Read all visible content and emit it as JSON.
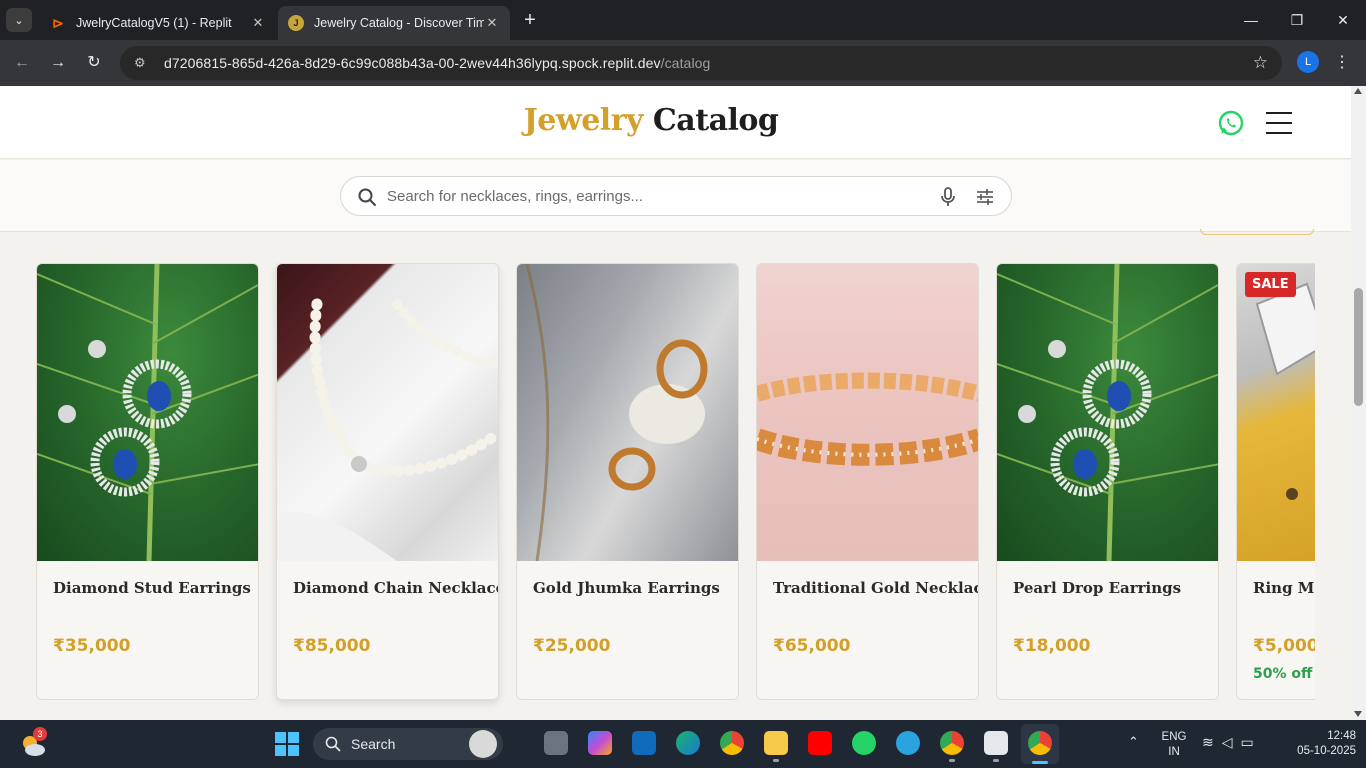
{
  "browser": {
    "tabs": [
      {
        "title": "JwelryCatalogV5 (1) - Replit",
        "favicon": "replit-icon",
        "active": false
      },
      {
        "title": "Jewelry Catalog - Discover Time",
        "favicon": "J",
        "active": true
      }
    ],
    "url_host": "d7206815-865d-426a-8d29-6c99c088b43a-00-2wev44h36lypq.spock.replit.dev",
    "url_path": "/catalog",
    "profile_initial": "L"
  },
  "site": {
    "logo_part1": "Jewelry",
    "logo_part2": "Catalog",
    "accent_color": "#d4a02c",
    "search_placeholder": "Search for necklaces, rings, earrings..."
  },
  "products": [
    {
      "name": "Diamond Stud Earrings",
      "price": "₹35,000",
      "image": "earrings-on-leaf"
    },
    {
      "name": "Diamond Chain Necklace",
      "price": "₹85,000",
      "image": "pearl-necklace"
    },
    {
      "name": "Gold Jhumka Earrings",
      "price": "₹25,000",
      "image": "gold-hoop-earrings"
    },
    {
      "name": "Traditional Gold Necklace",
      "price": "₹65,000",
      "image": "gold-bracelet"
    },
    {
      "name": "Pearl Drop Earrings",
      "price": "₹18,000",
      "image": "earrings-on-leaf"
    },
    {
      "name": "Ring Men",
      "price": "₹5,000",
      "discount": "50% off",
      "badge": "SALE",
      "image": "gold-ring"
    }
  ],
  "taskbar": {
    "search_label": "Search",
    "weather_badge": "3",
    "lang_line1": "ENG",
    "lang_line2": "IN",
    "time": "12:48",
    "date": "05-10-2025"
  }
}
